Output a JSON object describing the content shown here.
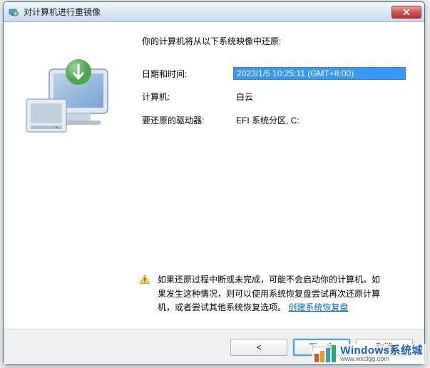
{
  "titlebar": {
    "title": "对计算机进行重镜像"
  },
  "heading": "你的计算机将从以下系统映像中还原:",
  "info": {
    "datetime_label": "日期和时间:",
    "datetime_value": "2023/1/5 10:25:11 (GMT+8:00)",
    "computer_label": "计算机:",
    "computer_value": "白云",
    "drives_label": "要还原的驱动器:",
    "drives_value": "EFI 系统分区, C:"
  },
  "warning": {
    "text_part1": "如果还原过程中断或未完成，可能不会启动你的计算机。如果发生这种情况，则可以使用系统恢复盘尝试再次还原计算机，或者尝试其他系统恢复选项。",
    "link": "创建系统恢复盘"
  },
  "footer": {
    "back": "<",
    "next": "下一步",
    "cancel": "取消"
  },
  "watermark": {
    "main": "Windows系统城",
    "sub": "www.wxclgg.com"
  }
}
